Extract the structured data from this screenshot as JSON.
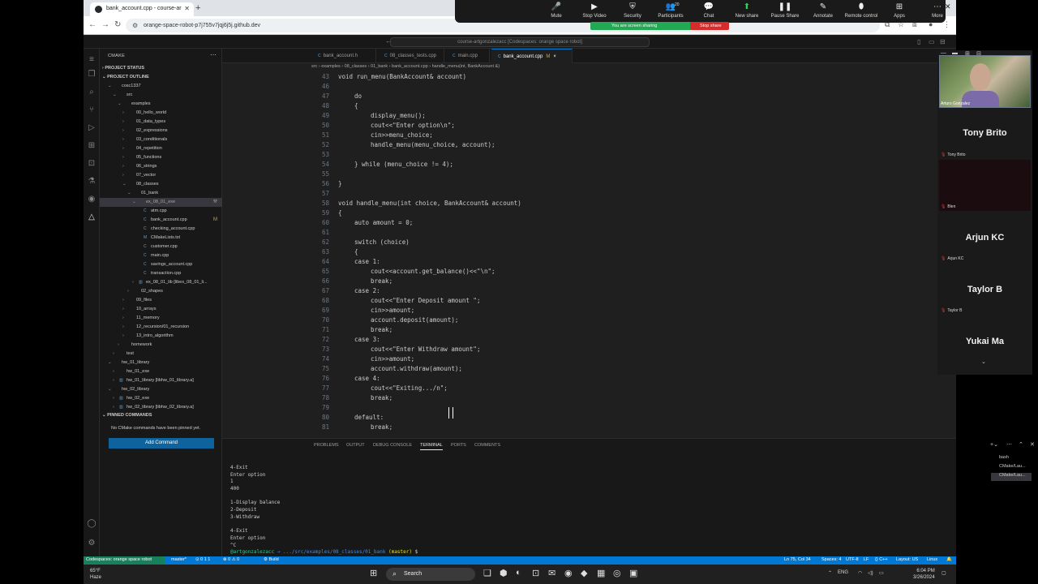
{
  "browser": {
    "tab_title": "bank_account.cpp - course-ar",
    "url": "orange-space-robot-p7j755v7jqj6j5j.github.dev"
  },
  "zoom": {
    "buttons": [
      {
        "label": "Mute",
        "icon": "mic-icon",
        "glyph": "🎤"
      },
      {
        "label": "Stop Video",
        "icon": "video-icon",
        "glyph": "▶"
      },
      {
        "label": "Security",
        "icon": "shield-icon",
        "glyph": "⛨"
      },
      {
        "label": "Participants",
        "icon": "people-icon",
        "glyph": "👥",
        "count": "20"
      },
      {
        "label": "Chat",
        "icon": "chat-icon",
        "glyph": "💬"
      },
      {
        "label": "New share",
        "icon": "share-icon",
        "glyph": "⬆",
        "accent": "#23d959"
      },
      {
        "label": "Pause Share",
        "icon": "pause-icon",
        "glyph": "❚❚"
      },
      {
        "label": "Annotate",
        "icon": "pen-icon",
        "glyph": "✎"
      },
      {
        "label": "Remote control",
        "icon": "mouse-icon",
        "glyph": "⬮"
      },
      {
        "label": "Apps",
        "icon": "apps-icon",
        "glyph": "⊞"
      },
      {
        "label": "More",
        "icon": "more-icon",
        "glyph": "⋯"
      }
    ],
    "sharing_text": "You are screen sharing",
    "stop_share": "Stop share",
    "participants": [
      {
        "name": "Arturo Gonzalez",
        "kind": "video"
      },
      {
        "name": "Tony Brito",
        "small": "Tony Brito"
      },
      {
        "name": "Blen",
        "kind": "dark"
      },
      {
        "name": "Arjun KC",
        "small": "Arjun KC"
      },
      {
        "name": "Taylor B",
        "small": "Taylor B"
      },
      {
        "name": "Yukai Ma"
      }
    ]
  },
  "vscode": {
    "command_center": "course-artgonzalezacc [Codespaces: orange space robot]",
    "sidebar": {
      "header": "CMAKE",
      "project_status": "PROJECT STATUS",
      "project_outline": "PROJECT OUTLINE",
      "pinned_commands": "PINNED COMMANDS",
      "pinned_message": "No CMake commands have been pinned yet.",
      "add_command": "Add Command",
      "tree": [
        {
          "label": "cosc1337",
          "indent": 1,
          "tw": "⌄"
        },
        {
          "label": "src",
          "indent": 2,
          "tw": "⌄"
        },
        {
          "label": "examples",
          "indent": 3,
          "tw": "⌄"
        },
        {
          "label": "00_hello_world",
          "indent": 4,
          "tw": "›"
        },
        {
          "label": "01_data_types",
          "indent": 4,
          "tw": "›"
        },
        {
          "label": "02_expressions",
          "indent": 4,
          "tw": "›"
        },
        {
          "label": "03_conditionals",
          "indent": 4,
          "tw": "›"
        },
        {
          "label": "04_repetition",
          "indent": 4,
          "tw": "›"
        },
        {
          "label": "05_functions",
          "indent": 4,
          "tw": "›"
        },
        {
          "label": "06_strings",
          "indent": 4,
          "tw": "›"
        },
        {
          "label": "07_vector",
          "indent": 4,
          "tw": "›"
        },
        {
          "label": "08_classes",
          "indent": 4,
          "tw": "⌄"
        },
        {
          "label": "01_bank",
          "indent": 5,
          "tw": "⌄"
        },
        {
          "label": "ex_08_01_exe",
          "indent": 6,
          "tw": "⌄",
          "sel": true,
          "badge": "⚒"
        },
        {
          "label": "atm.cpp",
          "indent": 7,
          "ic": "C"
        },
        {
          "label": "bank_account.cpp",
          "indent": 7,
          "ic": "C",
          "m": "M"
        },
        {
          "label": "checking_account.cpp",
          "indent": 7,
          "ic": "C"
        },
        {
          "label": "CMakeLists.txt",
          "indent": 7,
          "ic": "M"
        },
        {
          "label": "customer.cpp",
          "indent": 7,
          "ic": "C"
        },
        {
          "label": "main.cpp",
          "indent": 7,
          "ic": "C"
        },
        {
          "label": "savings_account.cpp",
          "indent": 7,
          "ic": "C"
        },
        {
          "label": "transaction.cpp",
          "indent": 7,
          "ic": "C"
        },
        {
          "label": "ex_08_01_lib [libex_08_01_li...",
          "indent": 6,
          "tw": "›",
          "ic": "▥"
        },
        {
          "label": "02_shapes",
          "indent": 5,
          "tw": "›"
        },
        {
          "label": "09_files",
          "indent": 4,
          "tw": "›"
        },
        {
          "label": "10_arrays",
          "indent": 4,
          "tw": "›"
        },
        {
          "label": "11_memory",
          "indent": 4,
          "tw": "›"
        },
        {
          "label": "12_recursion/01_recursion",
          "indent": 4,
          "tw": "›"
        },
        {
          "label": "13_intro_algorithm",
          "indent": 4,
          "tw": "›"
        },
        {
          "label": "homework",
          "indent": 3,
          "tw": "›"
        },
        {
          "label": "test",
          "indent": 2,
          "tw": "›"
        },
        {
          "label": "hw_01_library",
          "indent": 1,
          "tw": "⌄"
        },
        {
          "label": "hw_01_exe",
          "indent": 2,
          "tw": "›"
        },
        {
          "label": "hw_01_library [libhw_01_library.a]",
          "indent": 2,
          "tw": "›",
          "ic": "▥"
        },
        {
          "label": "hw_02_library",
          "indent": 1,
          "tw": "⌄"
        },
        {
          "label": "hw_02_exe",
          "indent": 2,
          "tw": "›",
          "ic": "▥"
        },
        {
          "label": "hw_02_library [libhw_02_library.a]",
          "indent": 2,
          "tw": "›",
          "ic": "▥"
        }
      ]
    },
    "tabs": [
      {
        "label": "bank_account.h",
        "on": false
      },
      {
        "label": "08_classes_tests.cpp",
        "on": false
      },
      {
        "label": "main.cpp",
        "on": false
      },
      {
        "label": "bank_account.cpp",
        "on": true,
        "mod": "M",
        "close": "×"
      }
    ],
    "breadcrumb": "src › examples › 08_classes › 01_bank › bank_account.cpp › handle_menu(int, BankAccount &)",
    "code_lines": [
      {
        "n": "43",
        "t": "void run_menu(BankAccount& account)",
        "ind": 0
      },
      {
        "n": "46",
        "t": "",
        "ind": 0
      },
      {
        "n": "47",
        "t": "do",
        "ind": 1
      },
      {
        "n": "48",
        "t": "{",
        "ind": 1
      },
      {
        "n": "49",
        "t": "display_menu();",
        "ind": 2
      },
      {
        "n": "50",
        "t": "cout<<\"Enter option\\n\";",
        "ind": 2
      },
      {
        "n": "51",
        "t": "cin>>menu_choice;",
        "ind": 2
      },
      {
        "n": "52",
        "t": "handle_menu(menu_choice, account);",
        "ind": 2
      },
      {
        "n": "53",
        "t": "",
        "ind": 0
      },
      {
        "n": "54",
        "t": "} while (menu_choice != 4);",
        "ind": 1
      },
      {
        "n": "55",
        "t": "",
        "ind": 0
      },
      {
        "n": "56",
        "t": "}",
        "ind": 0
      },
      {
        "n": "57",
        "t": "",
        "ind": 0
      },
      {
        "n": "58",
        "t": "void handle_menu(int choice, BankAccount& account)",
        "ind": 0
      },
      {
        "n": "59",
        "t": "{",
        "ind": 0
      },
      {
        "n": "60",
        "t": "auto amount = 0;",
        "ind": 1
      },
      {
        "n": "61",
        "t": "",
        "ind": 0
      },
      {
        "n": "62",
        "t": "switch (choice)",
        "ind": 1
      },
      {
        "n": "63",
        "t": "{",
        "ind": 1
      },
      {
        "n": "64",
        "t": "case 1:",
        "ind": 1
      },
      {
        "n": "65",
        "t": "cout<<account.get_balance()<<\"\\n\";",
        "ind": 2
      },
      {
        "n": "66",
        "t": "break;",
        "ind": 2
      },
      {
        "n": "67",
        "t": "case 2:",
        "ind": 1
      },
      {
        "n": "68",
        "t": "cout<<\"Enter Deposit amount \";",
        "ind": 2
      },
      {
        "n": "69",
        "t": "cin>>amount;",
        "ind": 2
      },
      {
        "n": "70",
        "t": "account.deposit(amount);",
        "ind": 2
      },
      {
        "n": "71",
        "t": "break;",
        "ind": 2
      },
      {
        "n": "72",
        "t": "case 3:",
        "ind": 1
      },
      {
        "n": "73",
        "t": "cout<<\"Enter Withdraw amount\";",
        "ind": 2
      },
      {
        "n": "74",
        "t": "cin>>amount;",
        "ind": 2
      },
      {
        "n": "75",
        "t": "account.withdraw(amount);",
        "ind": 2
      },
      {
        "n": "76",
        "t": "case 4:",
        "ind": 1
      },
      {
        "n": "77",
        "t": "cout<<\"Exiting.../n\";",
        "ind": 2
      },
      {
        "n": "78",
        "t": "break;",
        "ind": 2
      },
      {
        "n": "79",
        "t": "",
        "ind": 0
      },
      {
        "n": "80",
        "t": "default:",
        "ind": 1
      },
      {
        "n": "81",
        "t": "break;",
        "ind": 2
      }
    ],
    "panel": {
      "tabs": [
        "PROBLEMS",
        "OUTPUT",
        "DEBUG CONSOLE",
        "TERMINAL",
        "PORTS",
        "COMMENTS"
      ],
      "active_tab": "TERMINAL",
      "terminal_lines": [
        "4-Exit",
        "Enter option",
        "1",
        "400",
        "",
        "1-Display balance",
        "2-Deposit",
        "3-Withdraw",
        "",
        "4-Exit",
        "Enter option",
        "^C"
      ],
      "prompt_user": "@artgonzalezacc",
      "prompt_path": "→ .../src/examples/08_classes/01_bank",
      "prompt_branch": "(master)",
      "prompt_end": "$",
      "terminals": [
        "bash",
        "CMake/Lau...",
        "CMake/Lau..."
      ]
    },
    "status": {
      "remote": "Codespaces: orange space robot",
      "branch": "master*",
      "sync": "⊙ 0 1 1",
      "problems": "⊗ 0 ⚠ 0",
      "build": "⚙ Build",
      "position": "Ln 75, Col 34",
      "spaces": "Spaces: 4",
      "encoding": "UTF-8",
      "eol": "LF",
      "lang": "{} C++",
      "layout": "Layout: US",
      "os": "Linux"
    }
  },
  "taskbar": {
    "weather_temp": "65°F",
    "weather_desc": "Haze",
    "search": "Search",
    "lang": "ENG",
    "time": "6:04 PM",
    "date": "3/26/2024"
  }
}
